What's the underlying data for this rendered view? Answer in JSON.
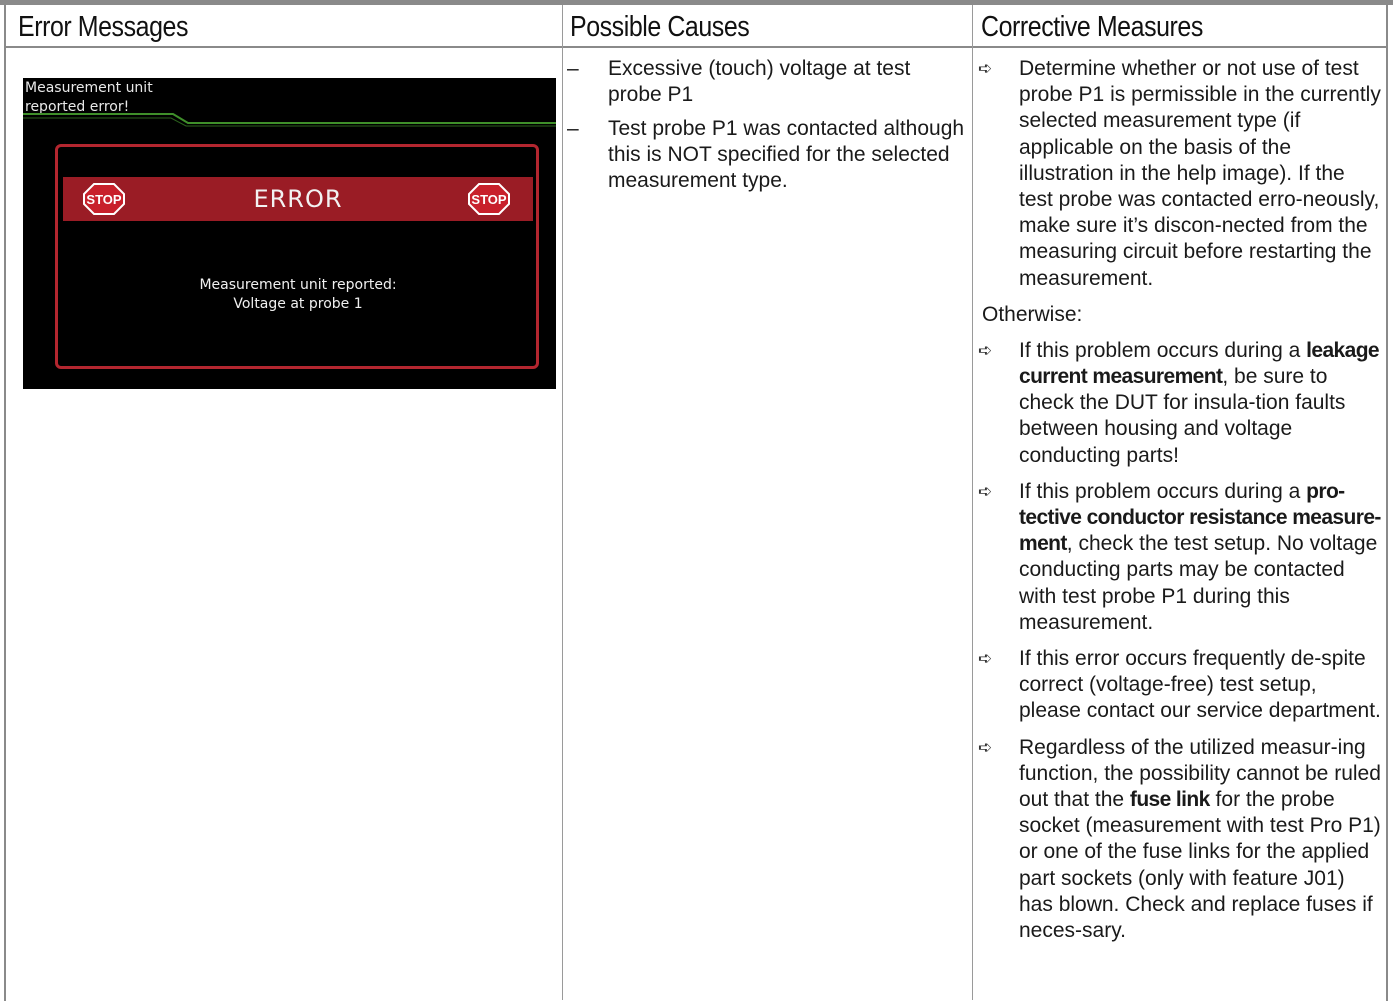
{
  "headers": [
    "Error Messages",
    "Possible Causes",
    "Corrective Measures"
  ],
  "screen": {
    "top_line1": "Measurement unit",
    "top_line2": "reported error!",
    "error_title": "ERROR",
    "stop_label": "STOP",
    "message_line1": "Measurement unit reported:",
    "message_line2": "Voltage at probe 1",
    "colors": {
      "frame": "#b3262f",
      "bar": "#9a1c25",
      "line": "#3f8f2a",
      "background": "#000000"
    }
  },
  "causes": [
    "Excessive (touch) voltage at test probe P1",
    "Test probe P1 was contacted although this is NOT specified for the selected measurement type."
  ],
  "measures": {
    "m1": "Determine whether or not use of test probe P1 is permissible in the currently selected measurement type (if applicable on the basis of the illustration in the help image). If the test probe was contacted erro-neously, make sure it’s discon-nected from the measuring circuit before restarting the measurement.",
    "otherwise": "Otherwise:",
    "m2_a": "If this problem occurs during a ",
    "m2_bold": "leakage current measurement",
    "m2_b": ", be sure to check the DUT for insula-tion faults between housing and voltage conducting parts!",
    "m3_a": "If this problem occurs during a ",
    "m3_bold": "pro-tective conductor resistance measure-ment",
    "m3_b": ", check the test setup. No voltage conducting parts may be contacted with test probe P1 during this measurement.",
    "m4": "If this error occurs frequently de-spite correct (voltage-free) test setup, please contact our service department.",
    "m5_a": "Regardless of the utilized measur-ing function, the possibility cannot be ruled out that the ",
    "m5_bold": "fuse link",
    "m5_b": " for the probe socket (measurement with test Pro P1) or one of the fuse links for the applied part sockets (only with feature J01) has blown. Check and replace fuses if neces-sary."
  },
  "bullet_icon": "arrow-right-icon",
  "dash_symbol": "–",
  "arrow_symbol": "➪"
}
